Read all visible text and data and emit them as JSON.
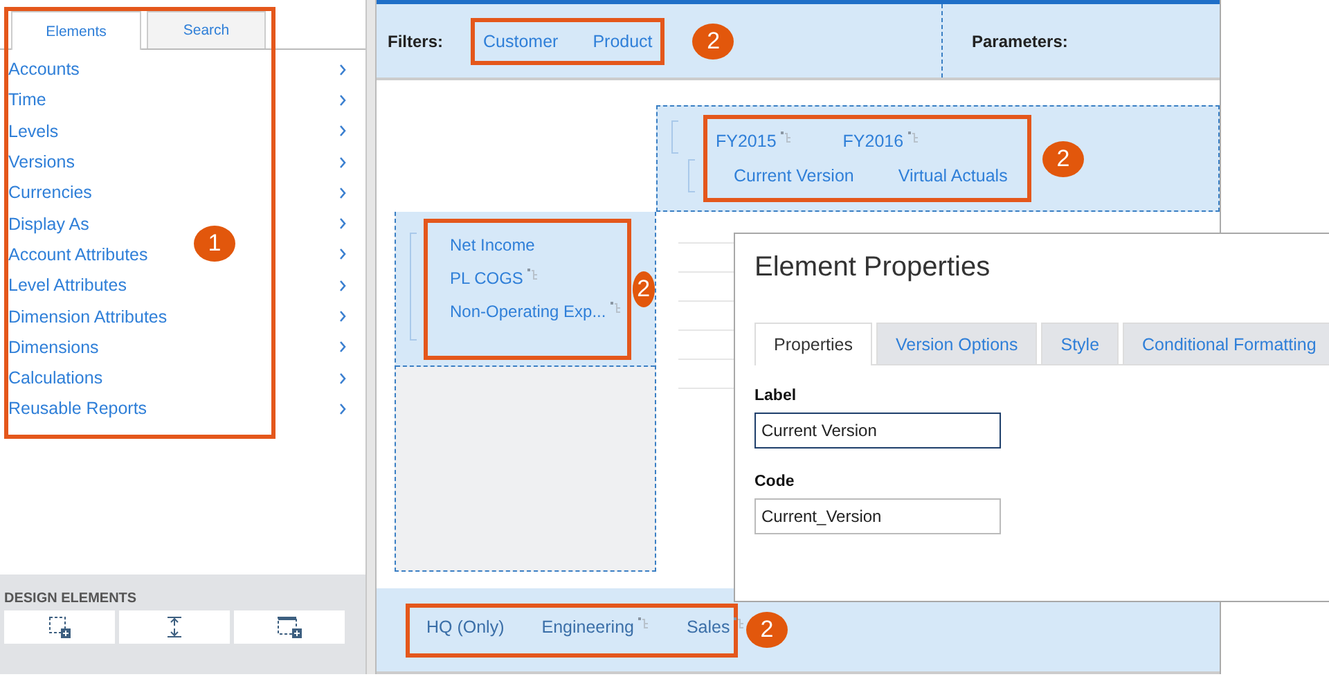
{
  "sidebar": {
    "tabs": [
      {
        "label": "Elements",
        "selected": true
      },
      {
        "label": "Search",
        "selected": false
      }
    ],
    "items": [
      {
        "label": "Accounts"
      },
      {
        "label": "Time"
      },
      {
        "label": "Levels"
      },
      {
        "label": "Versions"
      },
      {
        "label": "Currencies"
      },
      {
        "label": "Display As"
      },
      {
        "label": "Account Attributes"
      },
      {
        "label": "Level Attributes"
      },
      {
        "label": "Dimension Attributes"
      },
      {
        "label": "Dimensions"
      },
      {
        "label": "Calculations"
      },
      {
        "label": "Reusable Reports"
      }
    ],
    "callout": "1",
    "design_elements": {
      "title": "DESIGN ELEMENTS",
      "buttons": [
        {
          "kind": "add-box"
        },
        {
          "kind": "spacing"
        },
        {
          "kind": "add-panel"
        }
      ]
    }
  },
  "filters": {
    "label": "Filters:",
    "items": [
      {
        "label": "Customer",
        "hierarchy": false
      },
      {
        "label": "Product",
        "hierarchy": false
      }
    ],
    "callout": "2"
  },
  "parameters": {
    "label": "Parameters:"
  },
  "columns": {
    "rows": [
      [
        {
          "label": "FY2015",
          "hierarchy": true
        },
        {
          "label": "FY2016",
          "hierarchy": true
        }
      ],
      [
        {
          "label": "Current Version",
          "hierarchy": false
        },
        {
          "label": "Virtual Actuals",
          "hierarchy": false
        }
      ]
    ],
    "callout": "2"
  },
  "rows": {
    "items": [
      {
        "label": "Net Income",
        "hierarchy": false
      },
      {
        "label": "PL COGS",
        "hierarchy": true
      },
      {
        "label": "Non-Operating Exp...",
        "hierarchy": true
      }
    ],
    "callout": "2"
  },
  "bottom": {
    "items": [
      {
        "label": "HQ (Only)",
        "hierarchy": false
      },
      {
        "label": "Engineering",
        "hierarchy": true
      },
      {
        "label": "Sales",
        "hierarchy": true
      }
    ],
    "callout": "2"
  },
  "dialog": {
    "title": "Element Properties",
    "tabs": [
      {
        "label": "Properties",
        "selected": true
      },
      {
        "label": "Version Options",
        "selected": false
      },
      {
        "label": "Style",
        "selected": false
      },
      {
        "label": "Conditional Formatting",
        "selected": false
      }
    ],
    "fields": [
      {
        "label": "Label",
        "value": "Current Version",
        "focused": true
      },
      {
        "label": "Code",
        "value": "Current_Version",
        "focused": false
      }
    ]
  }
}
